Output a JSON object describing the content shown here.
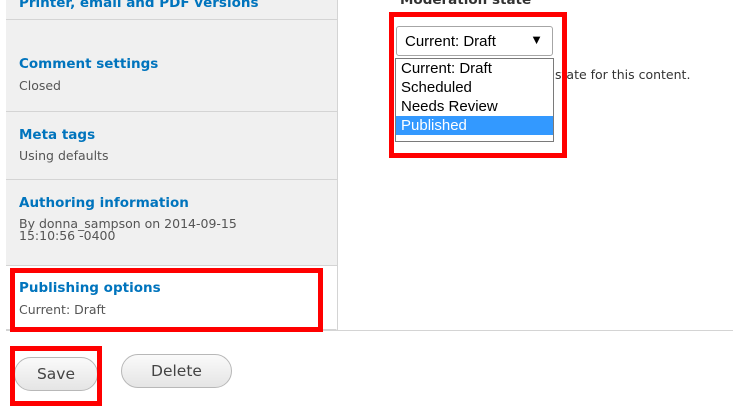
{
  "sidebar": {
    "tabs": [
      {
        "title": "Printer, email and PDF versions",
        "summary": ""
      },
      {
        "title": "Comment settings",
        "summary": "Closed"
      },
      {
        "title": "Meta tags",
        "summary": "Using defaults"
      },
      {
        "title": "Authoring information",
        "summary_line1": "By donna_sampson on 2014-09-15",
        "summary_line2": "15:10:56 -0400"
      },
      {
        "title": "Publishing options",
        "summary": "Current: Draft"
      }
    ]
  },
  "moderation": {
    "label": "Moderation state",
    "selected": "Current: Draft",
    "arrow_icon": "▼",
    "options": [
      "Current: Draft",
      "Scheduled",
      "Needs Review",
      "Published"
    ],
    "highlighted_option": "Published",
    "description": "state for this content."
  },
  "actions": {
    "save_label": "Save",
    "delete_label": "Delete"
  },
  "colors": {
    "link": "#0074bd",
    "highlight_box": "#ff0000",
    "option_selected_bg": "#3399ff"
  }
}
